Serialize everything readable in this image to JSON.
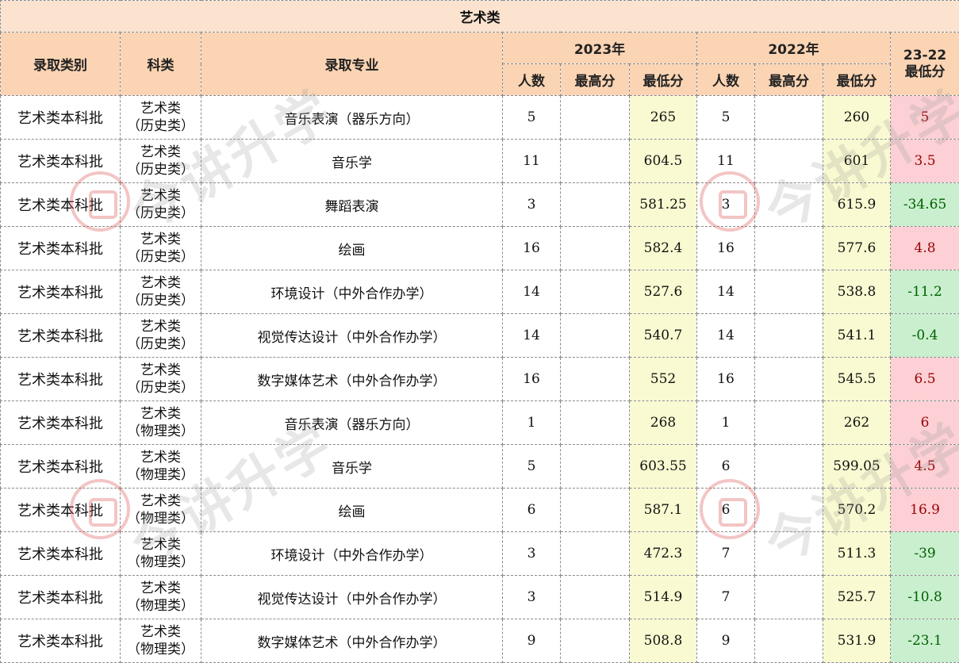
{
  "title": "艺术类",
  "headers": {
    "category": "录取类别",
    "subject": "科类",
    "major": "录取专业",
    "year_a": "2023年",
    "year_b": "2022年",
    "diff_line1": "23-22",
    "diff_line2": "最低分",
    "count": "人数",
    "max": "最高分",
    "min": "最低分"
  },
  "watermark": "今讲升学",
  "rows": [
    {
      "category": "艺术类本科批",
      "subject_1": "艺术类",
      "subject_2": "（历史类）",
      "major": "音乐表演（器乐方向）",
      "n23": "5",
      "max23": "",
      "min23": "265",
      "n22": "5",
      "max22": "",
      "min22": "260",
      "diff": "5",
      "sign": "pos"
    },
    {
      "category": "艺术类本科批",
      "subject_1": "艺术类",
      "subject_2": "（历史类）",
      "major": "音乐学",
      "n23": "11",
      "max23": "",
      "min23": "604.5",
      "n22": "11",
      "max22": "",
      "min22": "601",
      "diff": "3.5",
      "sign": "pos"
    },
    {
      "category": "艺术类本科批",
      "subject_1": "艺术类",
      "subject_2": "（历史类）",
      "major": "舞蹈表演",
      "n23": "3",
      "max23": "",
      "min23": "581.25",
      "n22": "3",
      "max22": "",
      "min22": "615.9",
      "diff": "-34.65",
      "sign": "neg"
    },
    {
      "category": "艺术类本科批",
      "subject_1": "艺术类",
      "subject_2": "（历史类）",
      "major": "绘画",
      "n23": "16",
      "max23": "",
      "min23": "582.4",
      "n22": "16",
      "max22": "",
      "min22": "577.6",
      "diff": "4.8",
      "sign": "pos"
    },
    {
      "category": "艺术类本科批",
      "subject_1": "艺术类",
      "subject_2": "（历史类）",
      "major": "环境设计（中外合作办学）",
      "n23": "14",
      "max23": "",
      "min23": "527.6",
      "n22": "14",
      "max22": "",
      "min22": "538.8",
      "diff": "-11.2",
      "sign": "neg"
    },
    {
      "category": "艺术类本科批",
      "subject_1": "艺术类",
      "subject_2": "（历史类）",
      "major": "视觉传达设计（中外合作办学）",
      "n23": "14",
      "max23": "",
      "min23": "540.7",
      "n22": "14",
      "max22": "",
      "min22": "541.1",
      "diff": "-0.4",
      "sign": "neg"
    },
    {
      "category": "艺术类本科批",
      "subject_1": "艺术类",
      "subject_2": "（历史类）",
      "major": "数字媒体艺术（中外合作办学）",
      "n23": "16",
      "max23": "",
      "min23": "552",
      "n22": "16",
      "max22": "",
      "min22": "545.5",
      "diff": "6.5",
      "sign": "pos"
    },
    {
      "category": "艺术类本科批",
      "subject_1": "艺术类",
      "subject_2": "（物理类）",
      "major": "音乐表演（器乐方向）",
      "n23": "1",
      "max23": "",
      "min23": "268",
      "n22": "1",
      "max22": "",
      "min22": "262",
      "diff": "6",
      "sign": "pos"
    },
    {
      "category": "艺术类本科批",
      "subject_1": "艺术类",
      "subject_2": "（物理类）",
      "major": "音乐学",
      "n23": "5",
      "max23": "",
      "min23": "603.55",
      "n22": "6",
      "max22": "",
      "min22": "599.05",
      "diff": "4.5",
      "sign": "pos"
    },
    {
      "category": "艺术类本科批",
      "subject_1": "艺术类",
      "subject_2": "（物理类）",
      "major": "绘画",
      "n23": "6",
      "max23": "",
      "min23": "587.1",
      "n22": "6",
      "max22": "",
      "min22": "570.2",
      "diff": "16.9",
      "sign": "pos"
    },
    {
      "category": "艺术类本科批",
      "subject_1": "艺术类",
      "subject_2": "（物理类）",
      "major": "环境设计（中外合作办学）",
      "n23": "3",
      "max23": "",
      "min23": "472.3",
      "n22": "7",
      "max22": "",
      "min22": "511.3",
      "diff": "-39",
      "sign": "neg"
    },
    {
      "category": "艺术类本科批",
      "subject_1": "艺术类",
      "subject_2": "（物理类）",
      "major": "视觉传达设计（中外合作办学）",
      "n23": "3",
      "max23": "",
      "min23": "514.9",
      "n22": "7",
      "max22": "",
      "min22": "525.7",
      "diff": "-10.8",
      "sign": "neg"
    },
    {
      "category": "艺术类本科批",
      "subject_1": "艺术类",
      "subject_2": "（物理类）",
      "major": "数字媒体艺术（中外合作办学）",
      "n23": "9",
      "max23": "",
      "min23": "508.8",
      "n22": "9",
      "max22": "",
      "min22": "531.9",
      "diff": "-23.1",
      "sign": "neg"
    }
  ]
}
